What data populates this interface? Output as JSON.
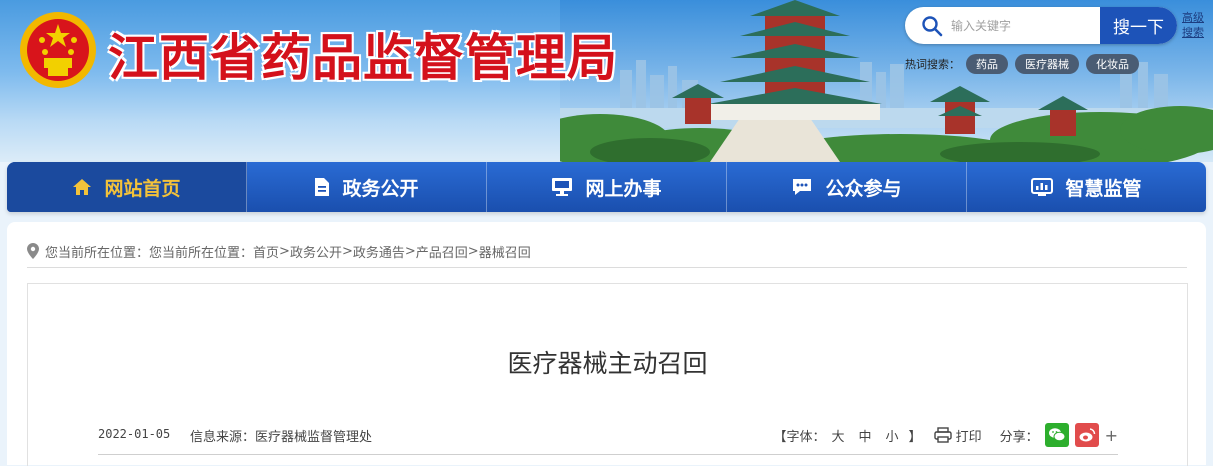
{
  "header": {
    "site_title": "江西省药品监督管理局",
    "search": {
      "placeholder": "输入关键字",
      "button_label": "搜一下",
      "advanced_label": "高级搜索"
    },
    "hot_search": {
      "label": "热词搜索：",
      "tags": [
        "药品",
        "医疗器械",
        "化妆品"
      ]
    }
  },
  "nav": {
    "items": [
      {
        "label": "网站首页",
        "icon": "home-icon",
        "active": true
      },
      {
        "label": "政务公开",
        "icon": "document-icon",
        "active": false
      },
      {
        "label": "网上办事",
        "icon": "monitor-icon",
        "active": false
      },
      {
        "label": "公众参与",
        "icon": "chat-icon",
        "active": false
      },
      {
        "label": "智慧监管",
        "icon": "dashboard-icon",
        "active": false
      }
    ]
  },
  "breadcrumb": {
    "prefix": "您当前所在位置：您当前所在位置：",
    "path": [
      "首页",
      "政务公开",
      "政务通告",
      "产品召回",
      "器械召回"
    ],
    "separator": ">"
  },
  "article": {
    "title": "医疗器械主动召回",
    "date": "2022-01-05",
    "source": "信息来源：医疗器械监督管理处",
    "font_label": "【字体：",
    "font_sizes": [
      "大",
      "中",
      "小"
    ],
    "font_close": "】",
    "print_label": "打印",
    "share_label": "分享：",
    "share_more": "+"
  },
  "colors": {
    "title_red": "#d4111b",
    "nav_blue": "#1d53b8",
    "active_gold": "#f3c23a",
    "wechat_green": "#2dae2d",
    "weibo_red": "#e14c4c"
  }
}
